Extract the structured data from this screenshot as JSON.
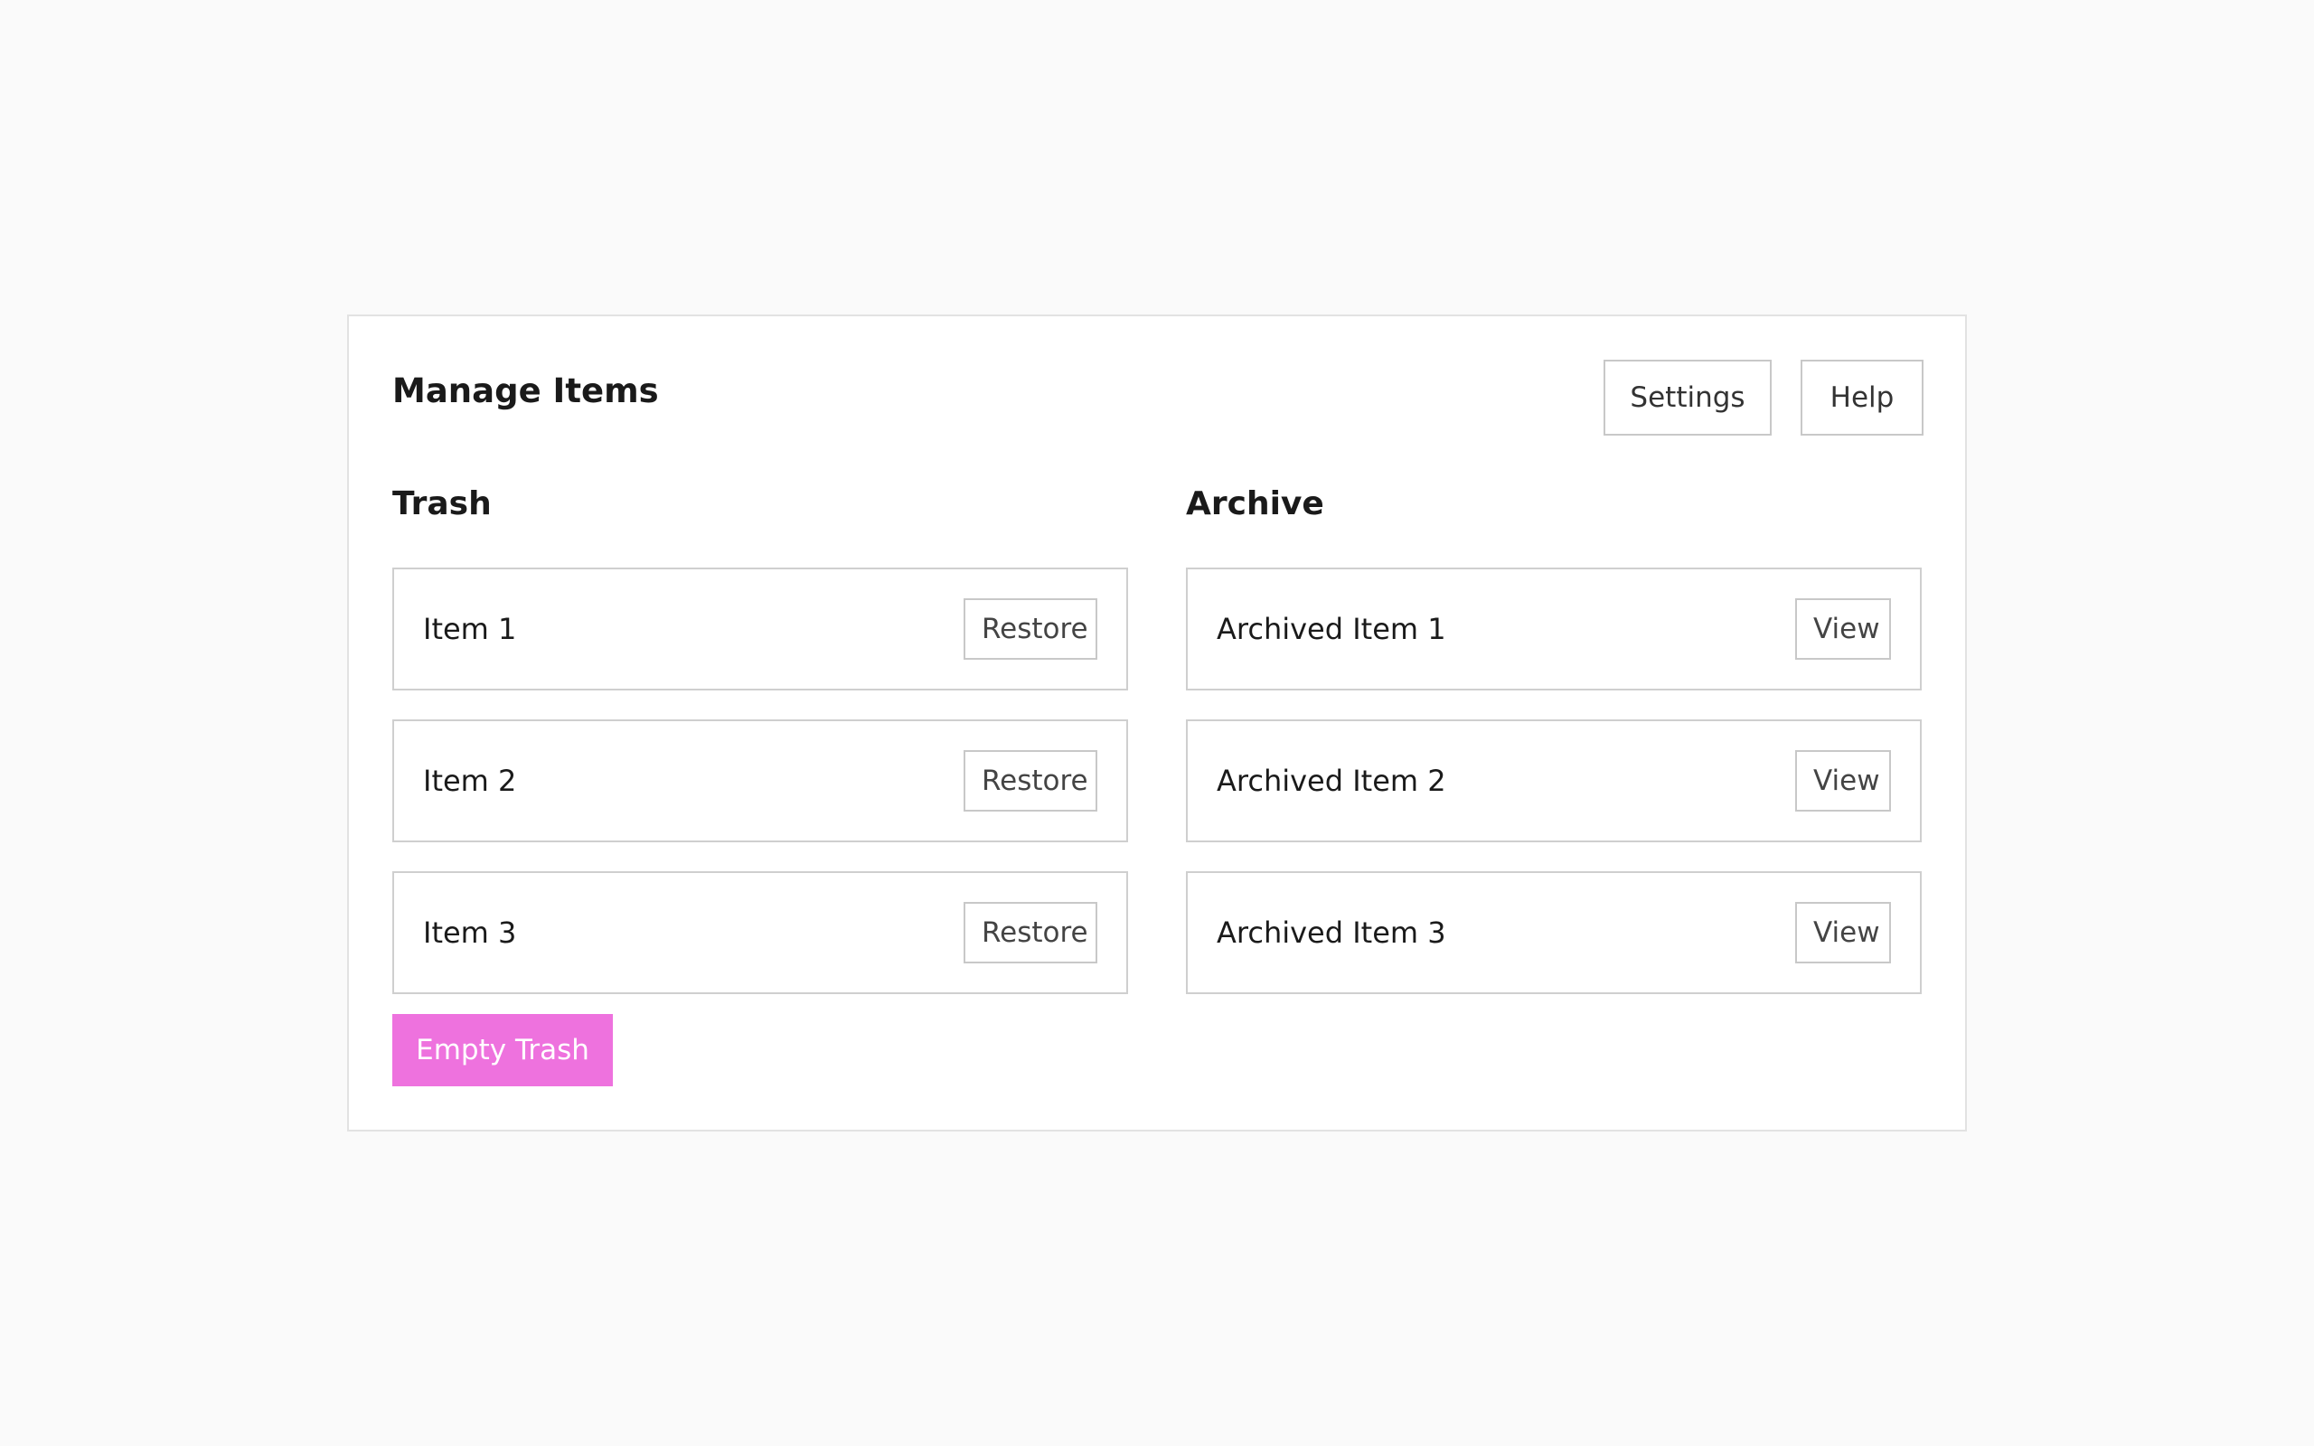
{
  "header": {
    "title": "Manage Items",
    "settings_label": "Settings",
    "help_label": "Help"
  },
  "trash": {
    "title": "Trash",
    "items": [
      {
        "label": "Item 1",
        "action": "Restore"
      },
      {
        "label": "Item 2",
        "action": "Restore"
      },
      {
        "label": "Item 3",
        "action": "Restore"
      }
    ],
    "empty_label": "Empty Trash"
  },
  "archive": {
    "title": "Archive",
    "items": [
      {
        "label": "Archived Item 1",
        "action": "View"
      },
      {
        "label": "Archived Item 2",
        "action": "View"
      },
      {
        "label": "Archived Item 3",
        "action": "View"
      }
    ]
  },
  "colors": {
    "accent": "#ee72de",
    "background": "#fafafa",
    "panel": "#ffffff",
    "border": "#cfcfcf"
  }
}
